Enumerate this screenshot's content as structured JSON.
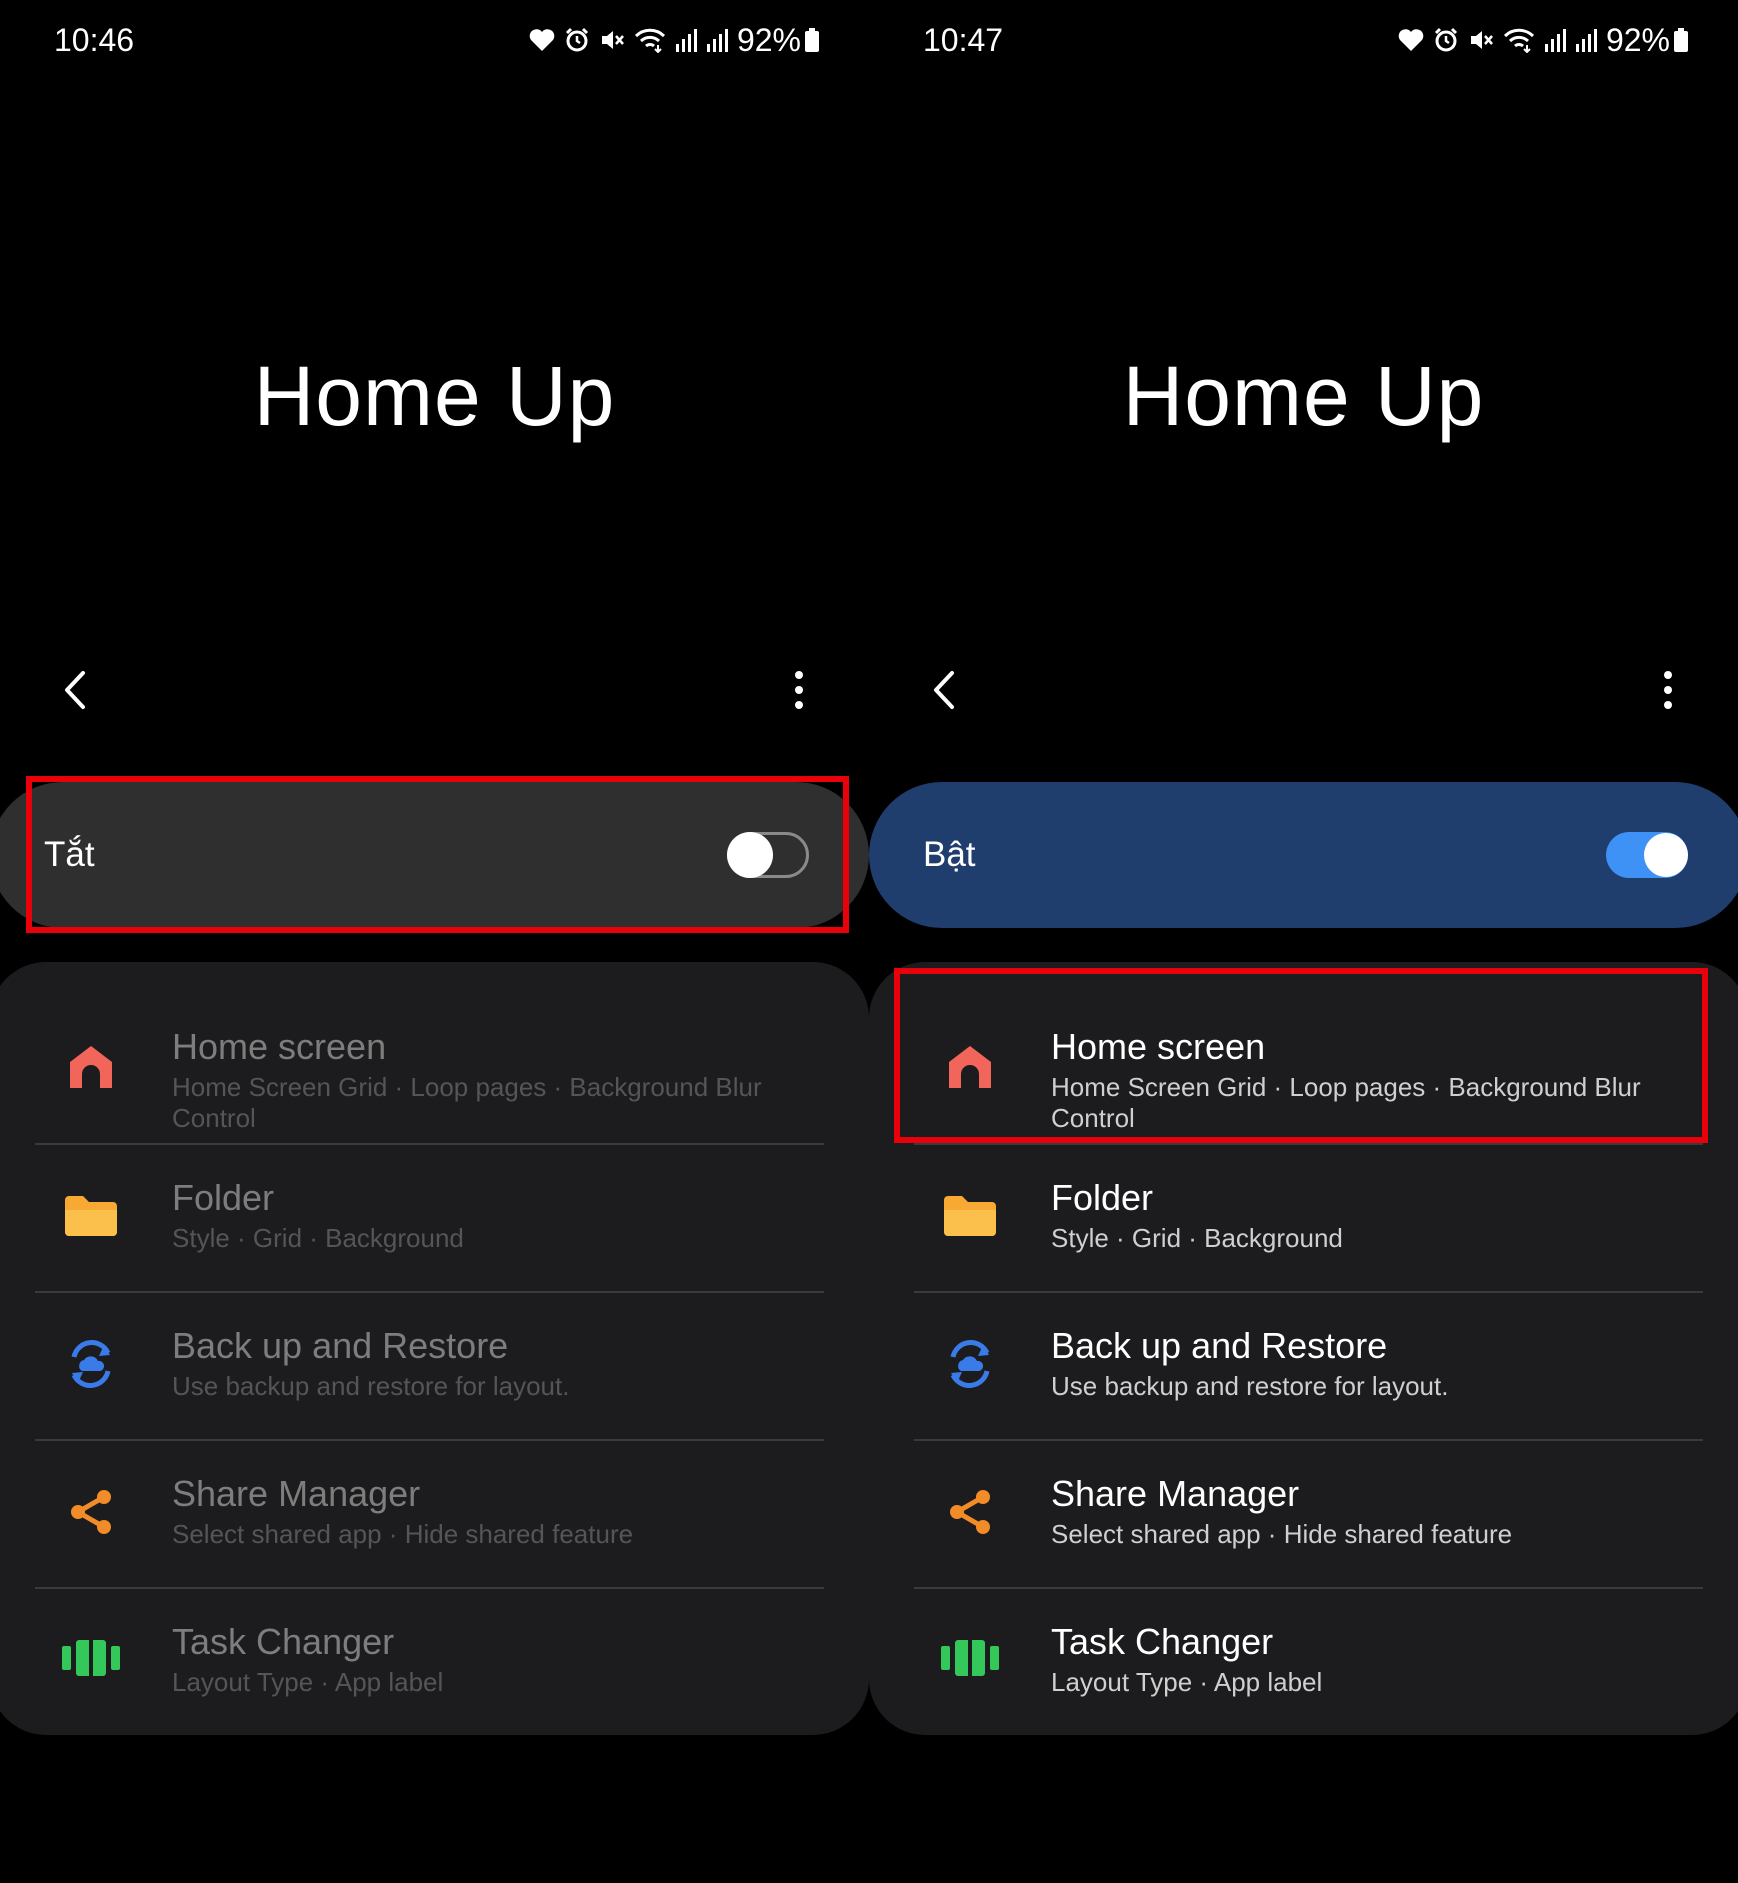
{
  "left": {
    "status": {
      "time": "10:46",
      "battery": "92%"
    },
    "title": "Home Up",
    "master": {
      "label": "Tắt",
      "on": false
    },
    "items": [
      {
        "title": "Home screen",
        "sub": "Home Screen Grid · Loop pages · Background Blur Control",
        "icon": "home-icon"
      },
      {
        "title": "Folder",
        "sub": "Style · Grid · Background",
        "icon": "folder-icon"
      },
      {
        "title": "Back up and Restore",
        "sub": "Use backup and restore for layout.",
        "icon": "backup-restore-icon"
      },
      {
        "title": "Share Manager",
        "sub": "Select shared app · Hide shared feature",
        "icon": "share-icon"
      },
      {
        "title": "Task Changer",
        "sub": "Layout Type · App label",
        "icon": "task-changer-icon"
      }
    ]
  },
  "right": {
    "status": {
      "time": "10:47",
      "battery": "92%"
    },
    "title": "Home Up",
    "master": {
      "label": "Bật",
      "on": true
    },
    "items": [
      {
        "title": "Home screen",
        "sub": "Home Screen Grid · Loop pages · Background Blur Control",
        "icon": "home-icon"
      },
      {
        "title": "Folder",
        "sub": "Style · Grid · Background",
        "icon": "folder-icon"
      },
      {
        "title": "Back up and Restore",
        "sub": "Use backup and restore for layout.",
        "icon": "backup-restore-icon"
      },
      {
        "title": "Share Manager",
        "sub": "Select shared app · Hide shared feature",
        "icon": "share-icon"
      },
      {
        "title": "Task Changer",
        "sub": "Layout Type · App label",
        "icon": "task-changer-icon"
      }
    ]
  },
  "colors": {
    "highlight": "#e8000b",
    "master_on_bg": "#1f3d6d",
    "master_off_bg": "#2f2f2f",
    "switch_on": "#3e91f5",
    "home_icon": "#f2655a",
    "folder_icon": "#f7a934",
    "backup_icon": "#3a7bea",
    "share_icon": "#f28c28",
    "task_icon": "#34c759"
  }
}
